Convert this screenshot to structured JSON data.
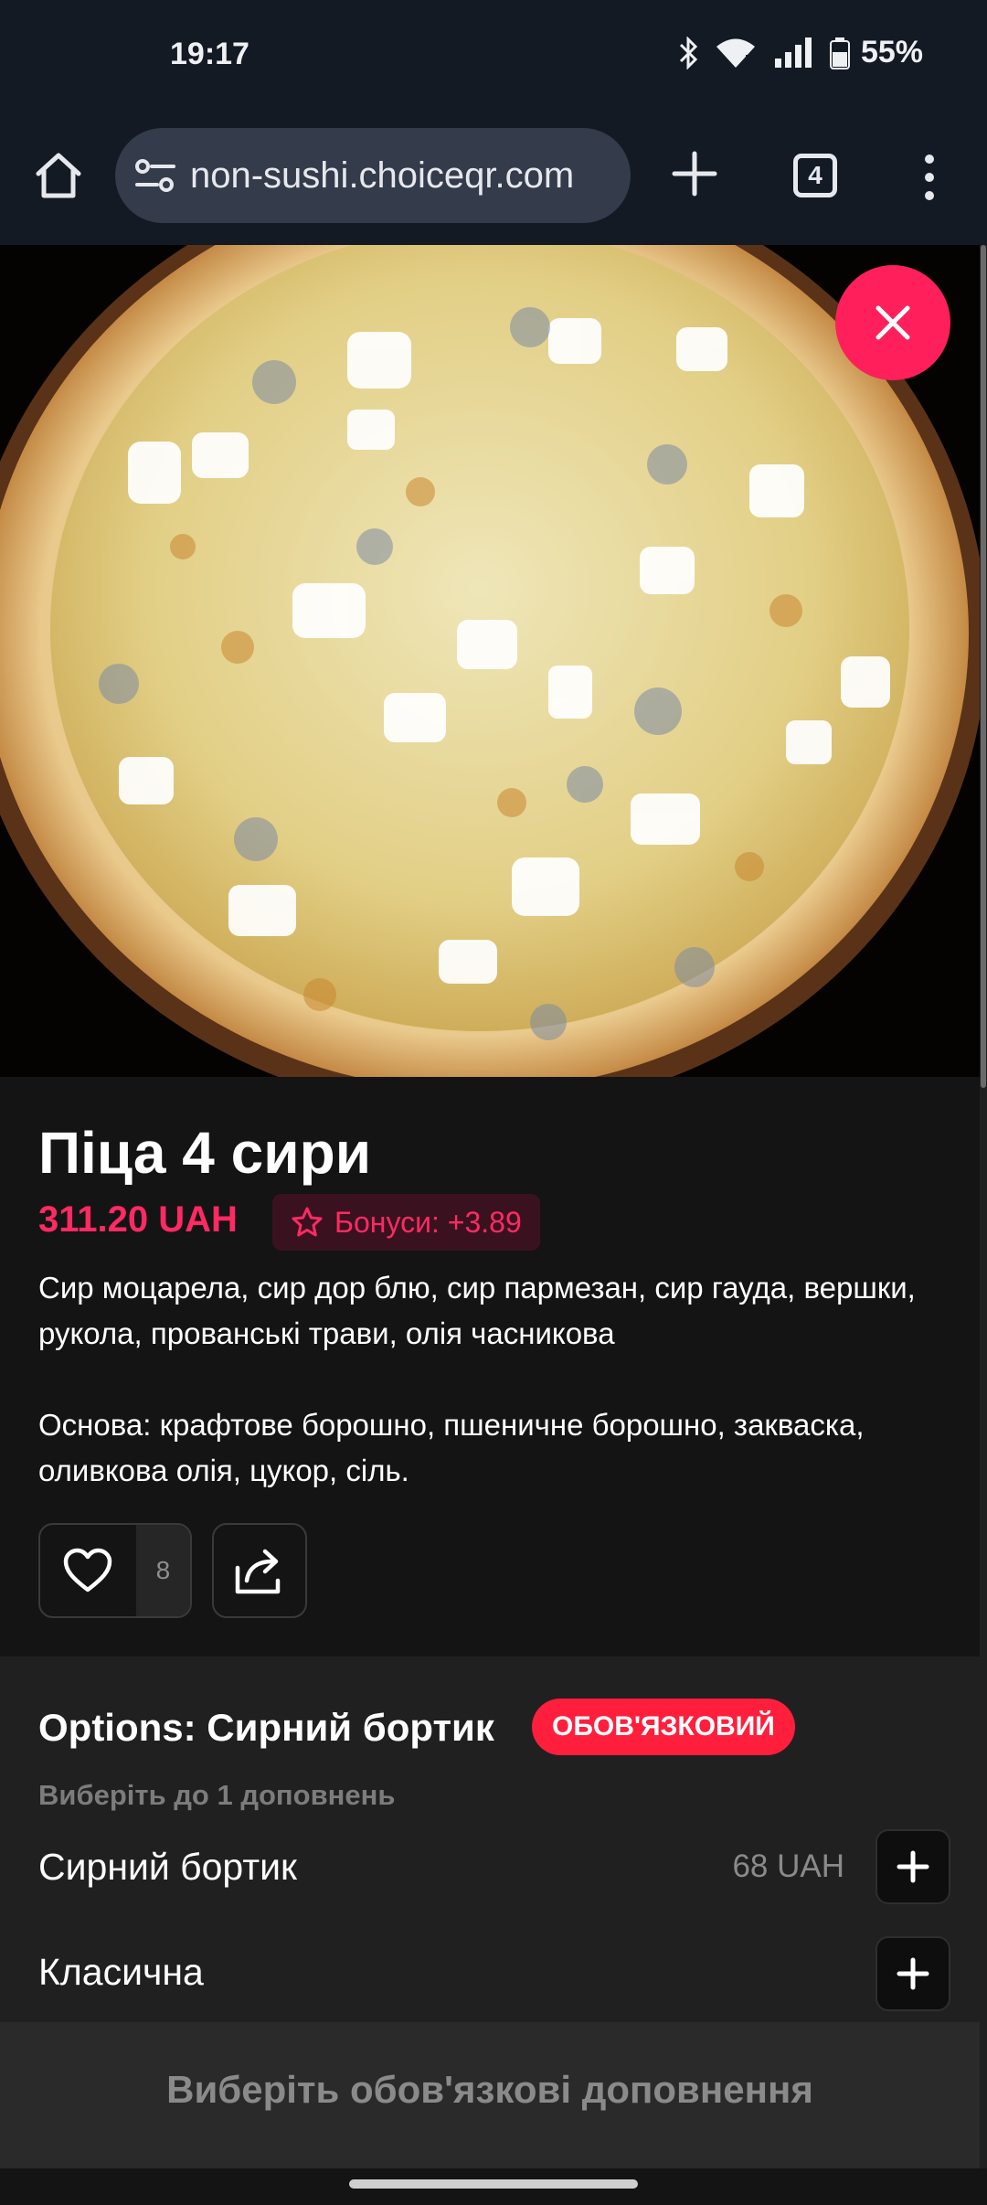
{
  "status_bar": {
    "time": "19:17",
    "battery": "55%",
    "icons": [
      "bluetooth-icon",
      "wifi-icon",
      "signal-icon",
      "battery-icon"
    ]
  },
  "browser": {
    "url": "non-sushi.choiceqr.com",
    "tab_count": "4",
    "icons": [
      "home-icon",
      "site-settings-icon",
      "plus-icon",
      "more-vert-icon"
    ]
  },
  "product": {
    "title": "Піца 4 сири",
    "price": "311.20 UAH",
    "bonus": "Бонуси: +3.89",
    "description_lines": [
      "Сир моцарела, сир дор блю, сир пармезан, сир гауда, вершки, рукола, прованські трави, олія часникова",
      "Основа: крафтове борошно, пшеничне борошно, закваска, оливкова олія, цукор, сіль."
    ],
    "likes": "8"
  },
  "options": {
    "title": "Options: Сирний бортик",
    "required_label": "ОБОВ'ЯЗКОВИЙ",
    "hint": "Виберіть до 1 доповнень",
    "items": [
      {
        "name": "Сирний бортик",
        "price": "68 UAH"
      },
      {
        "name": "Класична",
        "price": ""
      }
    ]
  },
  "cta": {
    "label": "Виберіть обов'язкові доповнення"
  },
  "colors": {
    "accent": "#ff2a63",
    "close_button": "#ff1f5a",
    "required_badge": "#ff1f3d"
  }
}
